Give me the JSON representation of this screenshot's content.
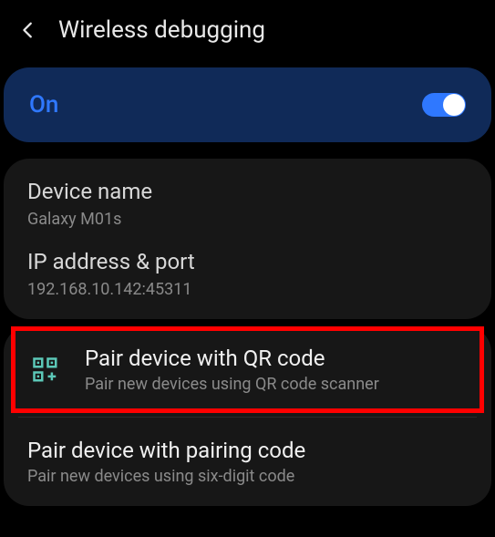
{
  "header": {
    "title": "Wireless debugging"
  },
  "toggle": {
    "label": "On",
    "state": true
  },
  "device": {
    "name_label": "Device name",
    "name_value": "Galaxy M01s",
    "ip_label": "IP address & port",
    "ip_value": "192.168.10.142:45311"
  },
  "pair": {
    "qr": {
      "title": "Pair device with QR code",
      "sub": "Pair new devices using QR code scanner"
    },
    "code": {
      "title": "Pair device with pairing code",
      "sub": "Pair new devices using six-digit code"
    }
  }
}
